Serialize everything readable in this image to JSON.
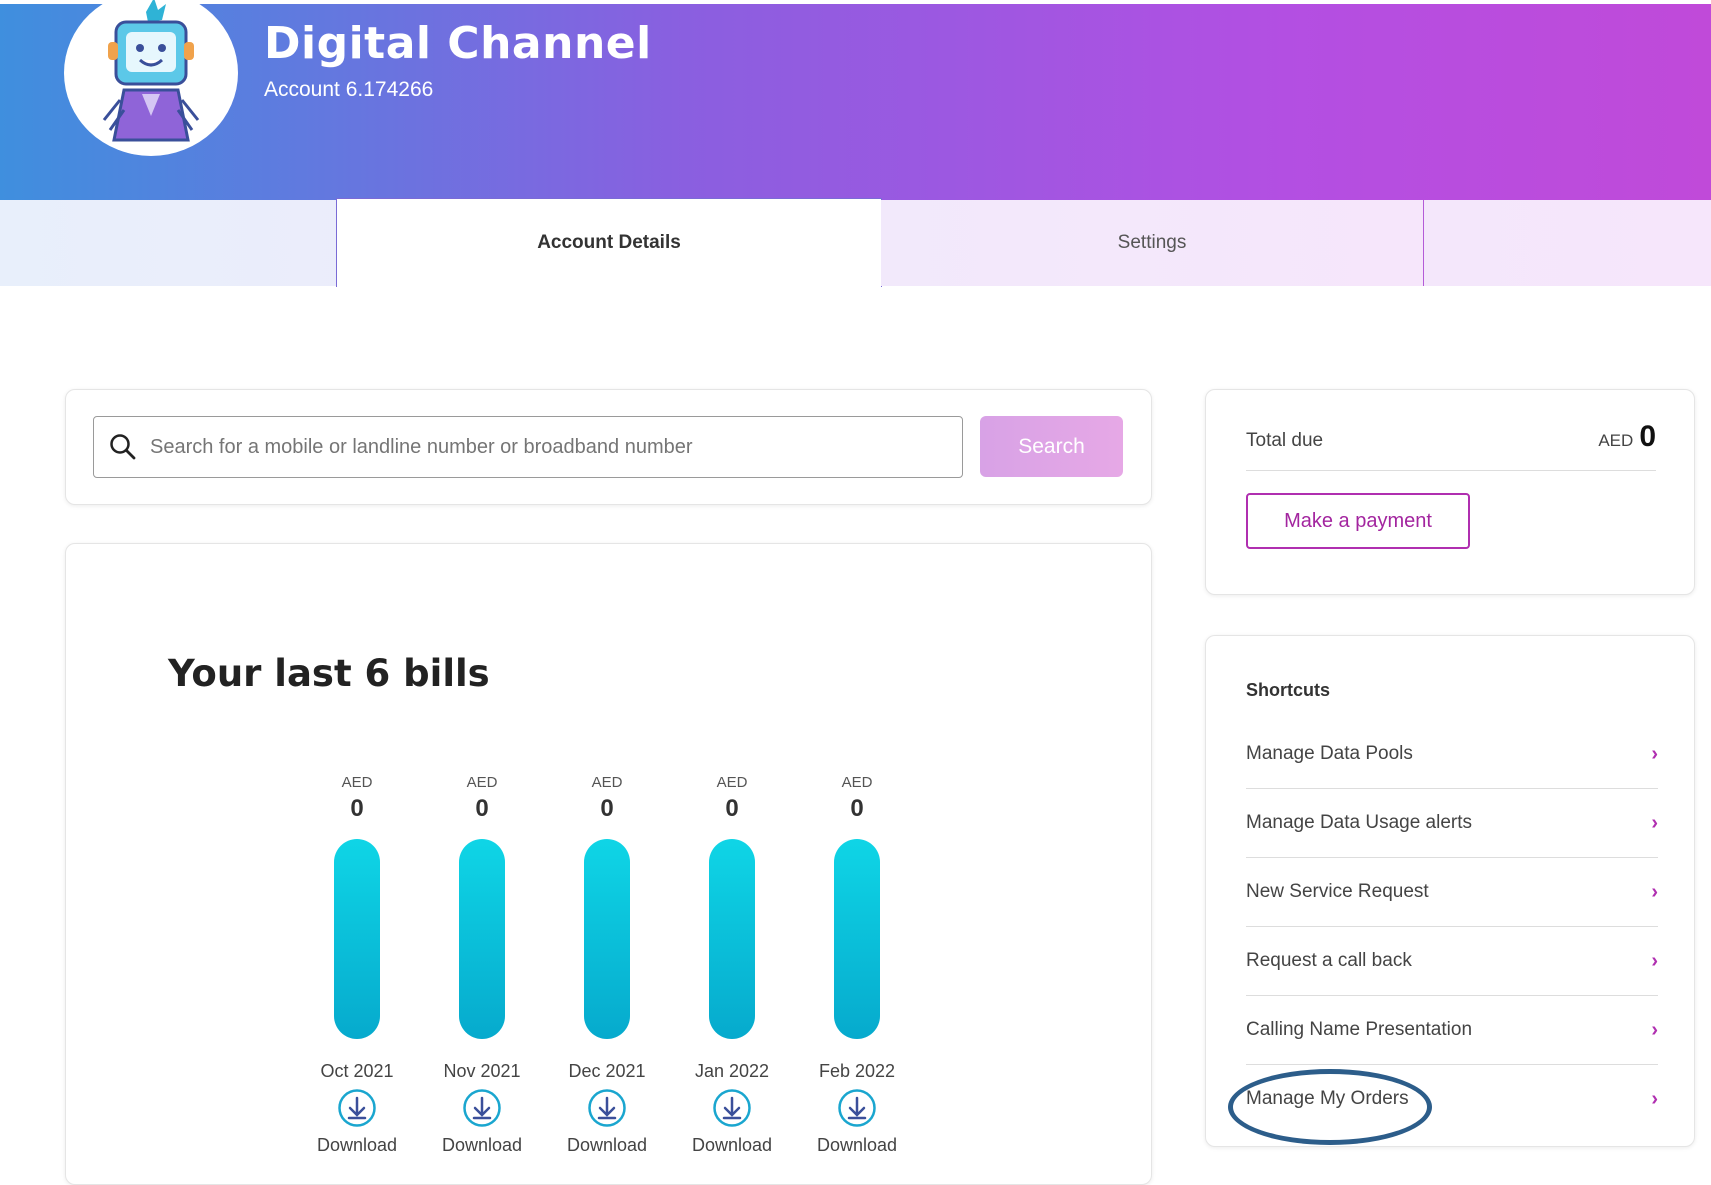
{
  "header": {
    "title": "Digital Channel",
    "account": "Account 6.174266"
  },
  "tabs": [
    {
      "label": "Account Details",
      "active": true
    },
    {
      "label": "Settings",
      "active": false
    }
  ],
  "search": {
    "placeholder": "Search for a mobile or landline number or broadband number",
    "button_label": "Search"
  },
  "bills": {
    "title": "Your last 6 bills",
    "currency": "AED",
    "items": [
      {
        "month": "Oct 2021",
        "amount": "0",
        "download": "Download"
      },
      {
        "month": "Nov 2021",
        "amount": "0",
        "download": "Download"
      },
      {
        "month": "Dec 2021",
        "amount": "0",
        "download": "Download"
      },
      {
        "month": "Jan 2022",
        "amount": "0",
        "download": "Download"
      },
      {
        "month": "Feb 2022",
        "amount": "0",
        "download": "Download"
      }
    ]
  },
  "total": {
    "label": "Total due",
    "currency": "AED",
    "amount": "0",
    "pay_button": "Make a payment"
  },
  "shortcuts": {
    "title": "Shortcuts",
    "items": [
      {
        "label": "Manage Data Pools"
      },
      {
        "label": "Manage Data Usage alerts"
      },
      {
        "label": "New Service Request"
      },
      {
        "label": "Request a call back"
      },
      {
        "label": "Calling Name Presentation"
      },
      {
        "label": "Manage My Orders"
      }
    ]
  },
  "colors": {
    "accent": "#b02fb0",
    "bar": "#06aacd",
    "highlight": "#2c5d8a"
  }
}
